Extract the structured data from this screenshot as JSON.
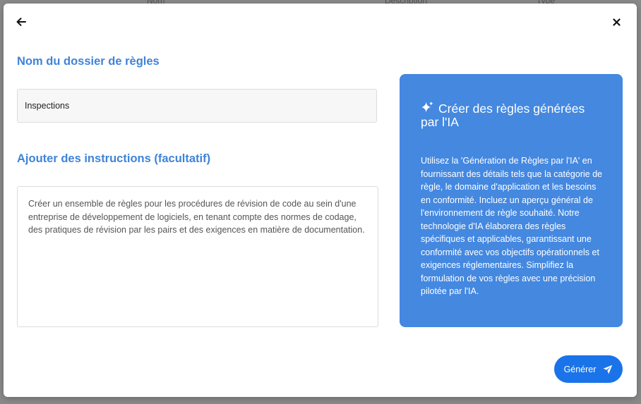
{
  "background_table": {
    "columns": [
      "Nom",
      "Description",
      "Type"
    ]
  },
  "modal": {
    "back_icon": "arrow-left-icon",
    "close_icon": "close-icon",
    "name_section": {
      "label": "Nom du dossier de règles",
      "value": "Inspections"
    },
    "instructions_section": {
      "label": "Ajouter des instructions (facultatif)",
      "placeholder": "Créer un ensemble de règles pour les procédures de révision de code au sein d'une entreprise de développement de logiciels, en tenant compte des normes de codage, des pratiques de révision par les pairs et des exigences en matière de documentation."
    },
    "info_panel": {
      "icon": "sparkle-icon",
      "title": "Créer des règles générées par l'IA",
      "text": "Utilisez la 'Génération de Règles par l'IA' en fournissant des détails tels que la catégorie de règle, le domaine d'application et les besoins en conformité. Incluez un aperçu général de l'environnement de règle souhaité. Notre technologie d'IA élaborera des règles spécifiques et applicables, garantissant une conformité avec vos objectifs opérationnels et exigences réglementaires. Simplifiez la formulation de vos règles avec une précision pilotée par l'IA."
    },
    "generate_button": {
      "label": "Générer",
      "icon": "send-icon"
    }
  },
  "colors": {
    "accent": "#3f83d8",
    "panel": "#4488e0",
    "button": "#1a73e8"
  }
}
